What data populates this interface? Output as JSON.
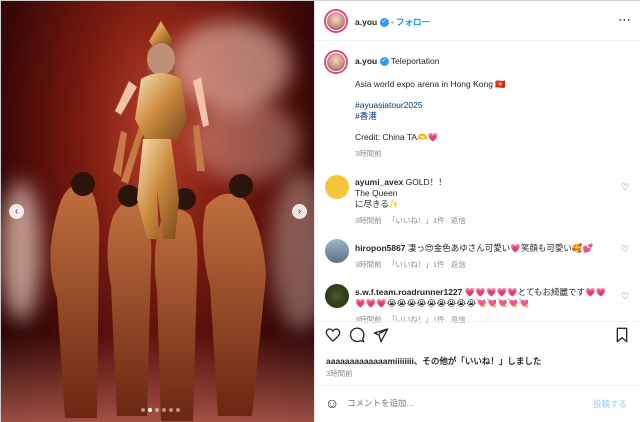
{
  "header": {
    "username": "a.you",
    "separator": "•",
    "follow_label": "フォロー",
    "more_icon": "ellipsis"
  },
  "post": {
    "username": "a.you",
    "location": "Teleportation",
    "caption_line1": "Asia world expo arena in Hong Kong 🇭🇰",
    "hashtag1": "#ayuasiatour2025",
    "hashtag2": "#香港",
    "credit": "Credit: China TA🫶💗",
    "time": "3時間前"
  },
  "comments": [
    {
      "username": "ayumi_avex",
      "text": "GOLD！！",
      "line2": "The Queen",
      "line3": "に尽きる✨",
      "time": "3時間前",
      "likes": "「いいね！」1件",
      "reply": "返信"
    },
    {
      "username": "hiropon5867",
      "text": "凄っ😍金色あゆさん可愛い💗笑顔も可愛い🥰💕",
      "time": "3時間前",
      "likes": "「いいね！」1件",
      "reply": "返信"
    },
    {
      "username": "s.w.f.team.roadrunner1227",
      "text": "💗💗💗💗💗とてもお綺麗です💗💗",
      "line2": "💗💗💗😭😭😭😭😭😭😭😭😭💘💘💘💘💘",
      "time": "3時間前",
      "likes": "「いいね！」1件",
      "reply": "返信"
    }
  ],
  "likes_line": {
    "names": "aaaaaaaaaaaaamiiiiiiii、",
    "rest": "その他が「いいね！」しました"
  },
  "post_time": "3時間前",
  "comment_box": {
    "placeholder": "コメントを追加...",
    "post_label": "投稿する"
  },
  "carousel": {
    "slides": 6,
    "active_index": 1
  },
  "colors": {
    "accent": "#0095f6",
    "ring": "#d84b8b",
    "verified": "#3897f0"
  }
}
